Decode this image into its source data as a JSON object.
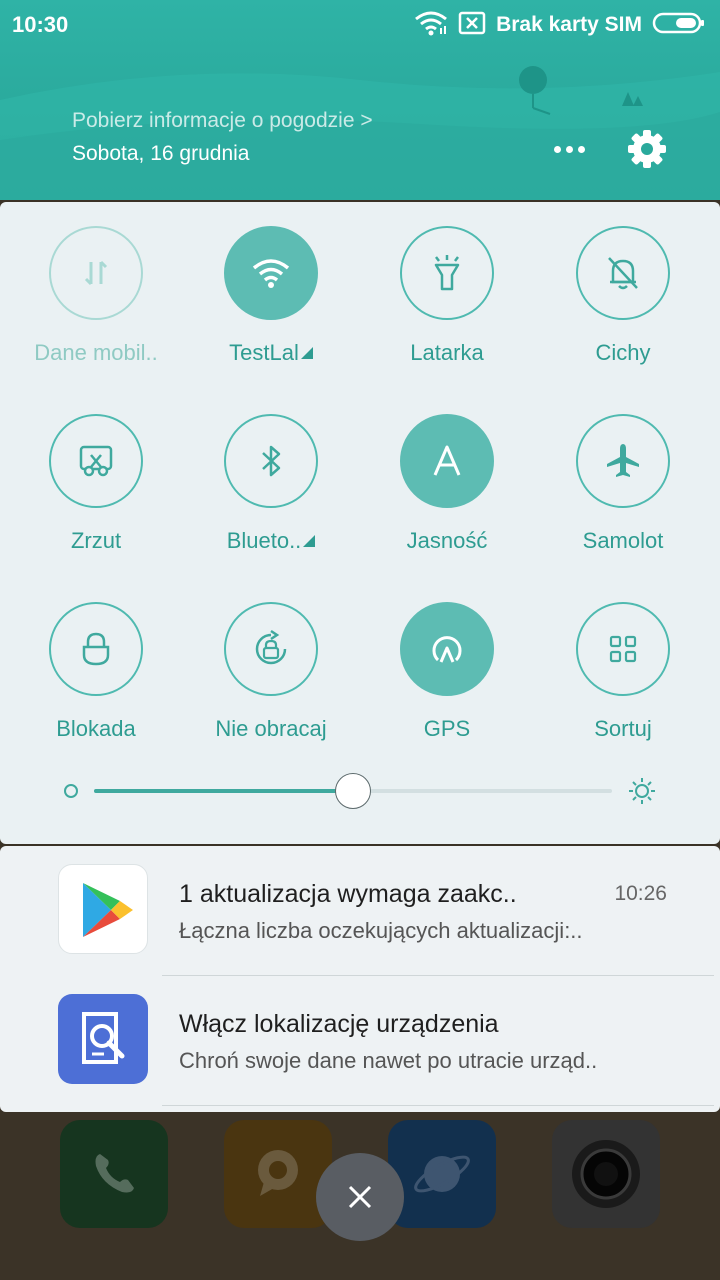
{
  "status_bar": {
    "time": "10:30",
    "sim_status": "Brak karty SIM",
    "icons": [
      "wifi-icon",
      "no-sim-icon",
      "battery-icon"
    ]
  },
  "header": {
    "weather_link": "Pobierz informacje o pogodzie >",
    "date": "Sobota, 16 grudnia",
    "accent_color": "#2aa99c"
  },
  "quick_settings": {
    "tiles": [
      {
        "label": "Dane mobil..",
        "icon": "mobile-data-icon",
        "state": "disabled"
      },
      {
        "label": "TestLal",
        "icon": "wifi-icon",
        "state": "on",
        "expandable": true
      },
      {
        "label": "Latarka",
        "icon": "flashlight-icon",
        "state": "off"
      },
      {
        "label": "Cichy",
        "icon": "silent-bell-icon",
        "state": "off"
      },
      {
        "label": "Zrzut",
        "icon": "screenshot-icon",
        "state": "off"
      },
      {
        "label": "Blueto..",
        "icon": "bluetooth-icon",
        "state": "off",
        "expandable": true
      },
      {
        "label": "Jasność",
        "icon": "auto-brightness-icon",
        "state": "on"
      },
      {
        "label": "Samolot",
        "icon": "airplane-icon",
        "state": "off"
      },
      {
        "label": "Blokada",
        "icon": "lock-icon",
        "state": "off"
      },
      {
        "label": "Nie obracaj",
        "icon": "rotation-lock-icon",
        "state": "off"
      },
      {
        "label": "GPS",
        "icon": "gps-icon",
        "state": "on"
      },
      {
        "label": "Sortuj",
        "icon": "grid-icon",
        "state": "off"
      }
    ],
    "brightness_level": 0.5,
    "active_color": "#5dbcb3"
  },
  "notifications": [
    {
      "app_icon": "play-store-icon",
      "title": "1 aktualizacja wymaga zaakc..",
      "subtitle": "Łączna liczba oczekujących aktualizacji:..",
      "time": "10:26"
    },
    {
      "app_icon": "find-device-icon",
      "title": "Włącz lokalizację urządzenia",
      "subtitle": "Chroń swoje dane nawet po utracie urząd..",
      "time": ""
    }
  ],
  "dock": {
    "apps": [
      "phone-icon",
      "messages-icon",
      "browser-icon",
      "camera-icon"
    ]
  }
}
